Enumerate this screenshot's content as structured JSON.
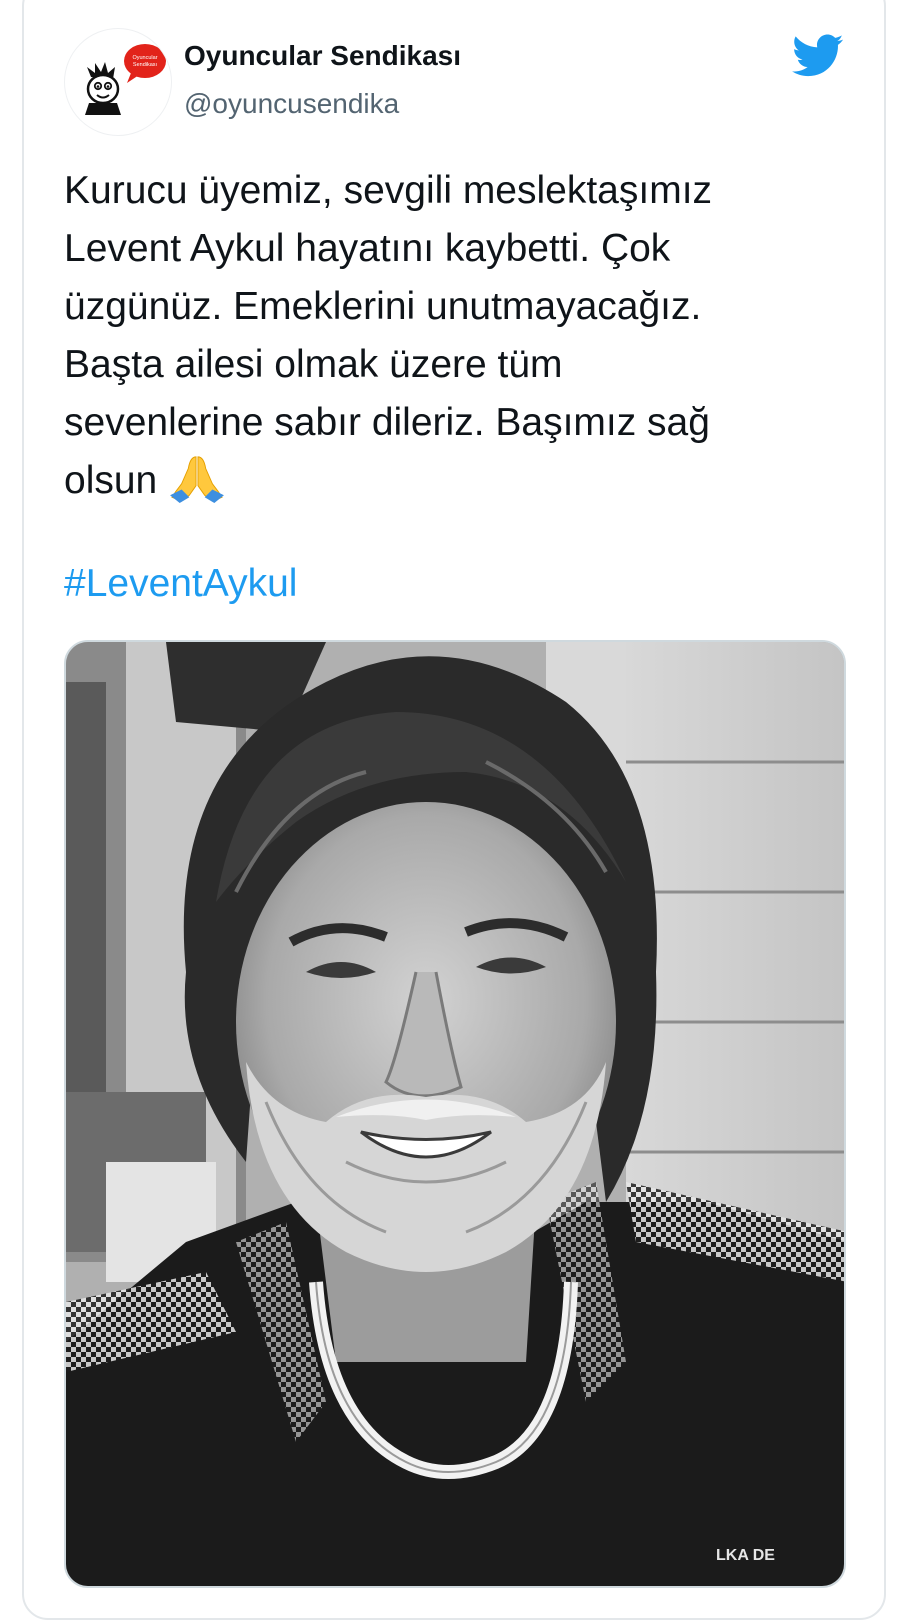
{
  "tweet": {
    "author": {
      "display_name": "Oyuncular Sendikası",
      "handle": "@oyuncusendika",
      "avatar_icon": "oyuncular-sendikasi-logo",
      "avatar_logo_text": [
        "Oyuncular",
        "Sendikası"
      ],
      "avatar_accent": "#e2231a"
    },
    "platform_icon": "twitter-bird-icon",
    "brand_color": "#1d9bf0",
    "text_lines": [
      "Kurucu üyemiz, sevgili meslektaşımız",
      "Levent Aykul hayatını kaybetti. Çok",
      "üzgünüz. Emeklerini unutmayacağız.",
      "Başta ailesi olmak üzere tüm",
      "sevenlerine sabır dileriz.  Başımız sağ",
      "olsun"
    ],
    "trailing_emoji": "folded-hands-emoji",
    "hashtag": "#LeventAykul",
    "media": {
      "type": "photo",
      "description_icon": "black-and-white-portrait-photo",
      "shirt_text": "LKA DE"
    }
  }
}
